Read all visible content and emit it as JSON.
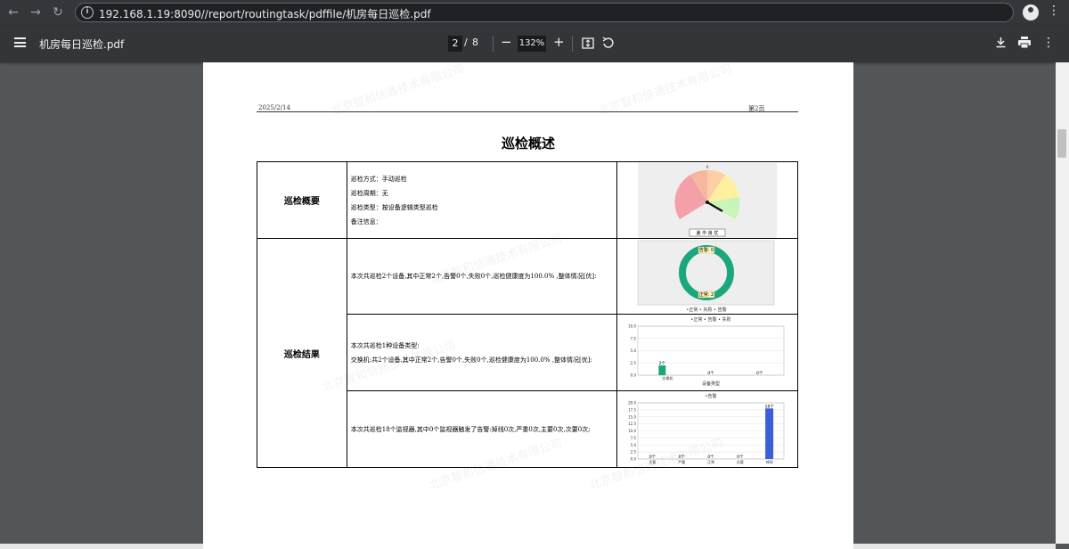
{
  "browser": {
    "url": "192.168.1.19:8090//report/routingtask/pdffile/机房每日巡检.pdf"
  },
  "pdf_toolbar": {
    "title": "机房每日巡检.pdf",
    "current_page": "2",
    "page_separator": "/",
    "total_pages": "8",
    "zoom": "132%"
  },
  "page": {
    "date": "2025/2/14",
    "page_label": "第2页",
    "section_title": "巡检概述",
    "watermark_text": "北京智和信通技术有限公司",
    "summary": {
      "category": "巡检概要",
      "lines": [
        "巡检方式：手动巡检",
        "巡检周期：无",
        "巡检类型：按设备逻辑类型巡检",
        "备注信息："
      ],
      "gauge_label": "差  中  良  优",
      "gauge_top_value": "0"
    },
    "results": {
      "category": "巡检结果",
      "row1_text": "本次共巡检2个设备,其中正常2个,告警0个,失败0个,巡检健康度为100.0% ,整体情况[优]:",
      "row2_text_a": "本次共巡检1种设备类型:",
      "row2_text_b": "交换机:共2个设备,其中正常2个,告警0个,失败0个,巡检健康度为100.0% ,整体情况[优]:",
      "row3_text": "本次共巡检18个监视器,其中0个监视器触发了告警:掉线0次,严重0次,主要0次,次要0次;"
    }
  },
  "chart_data": [
    {
      "type": "pie",
      "categories": [
        "告警",
        "正常"
      ],
      "values": [
        0,
        2
      ],
      "labels": [
        "告警: 0",
        "正常: 2"
      ],
      "legend": "•正常 • 失败 • 告警",
      "colors": [
        "#e8d44d",
        "#1aa77e"
      ]
    },
    {
      "type": "bar",
      "title": "•正常 • 告警 • 失败",
      "categories": [
        "交换机"
      ],
      "series": [
        {
          "name": "正常",
          "values": [
            2
          ],
          "labels": [
            "2个"
          ]
        },
        {
          "name": "告警",
          "values": [
            0
          ],
          "labels": [
            "0个"
          ]
        },
        {
          "name": "失败",
          "values": [
            0
          ],
          "labels": [
            "0个"
          ]
        }
      ],
      "yticks": [
        "0.0",
        "2.5",
        "5.0",
        "7.5",
        "10.0"
      ],
      "ylim": [
        0,
        10
      ],
      "xlabel": "设备类型",
      "colors": [
        "#1aa77e",
        "#e8d44d",
        "#d9534f"
      ]
    },
    {
      "type": "bar",
      "title": "•告警",
      "categories": [
        "主要",
        "严重",
        "正常",
        "次要",
        "掉线"
      ],
      "values": [
        0,
        0,
        0,
        0,
        18
      ],
      "labels": [
        "0个",
        "0个",
        "0个",
        "0个",
        "18个"
      ],
      "yticks": [
        "0.0",
        "2.5",
        "5.0",
        "7.5",
        "10.0",
        "12.5",
        "15.0",
        "17.5",
        "20.0"
      ],
      "ylim": [
        0,
        20
      ],
      "colors": [
        "#3a5fd9"
      ]
    }
  ]
}
